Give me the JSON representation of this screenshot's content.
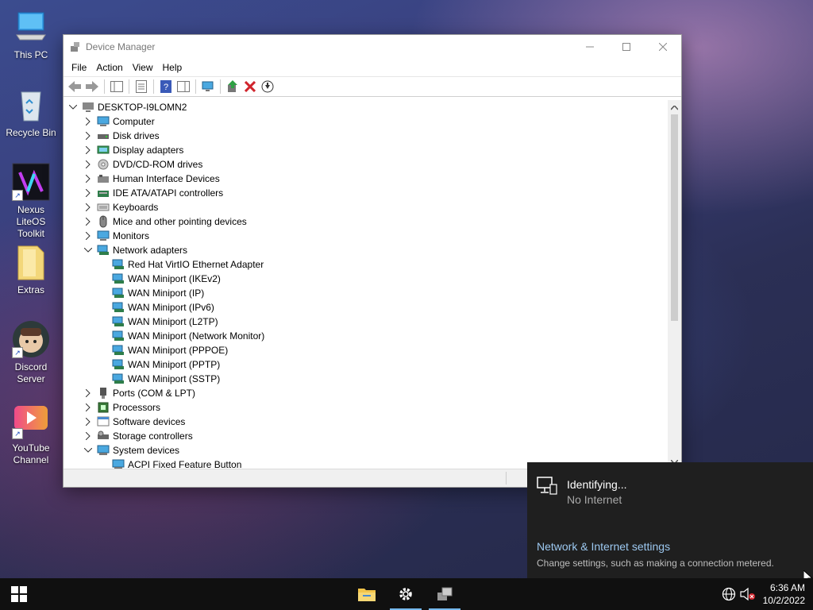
{
  "desktop": {
    "icons": [
      {
        "label": "This PC"
      },
      {
        "label": "Recycle Bin"
      },
      {
        "label": "Nexus LiteOS Toolkit"
      },
      {
        "label": "Extras"
      },
      {
        "label": "Discord Server"
      },
      {
        "label": "YouTube Channel"
      }
    ]
  },
  "window": {
    "title": "Device Manager",
    "menu": [
      "File",
      "Action",
      "View",
      "Help"
    ],
    "tree": {
      "root": "DESKTOP-I9LOMN2",
      "items": [
        {
          "label": "Computer"
        },
        {
          "label": "Disk drives"
        },
        {
          "label": "Display adapters"
        },
        {
          "label": "DVD/CD-ROM drives"
        },
        {
          "label": "Human Interface Devices"
        },
        {
          "label": "IDE ATA/ATAPI controllers"
        },
        {
          "label": "Keyboards"
        },
        {
          "label": "Mice and other pointing devices"
        },
        {
          "label": "Monitors"
        },
        {
          "label": "Network adapters"
        },
        {
          "label": "Red Hat VirtIO Ethernet Adapter"
        },
        {
          "label": "WAN Miniport (IKEv2)"
        },
        {
          "label": "WAN Miniport (IP)"
        },
        {
          "label": "WAN Miniport (IPv6)"
        },
        {
          "label": "WAN Miniport (L2TP)"
        },
        {
          "label": "WAN Miniport (Network Monitor)"
        },
        {
          "label": "WAN Miniport (PPPOE)"
        },
        {
          "label": "WAN Miniport (PPTP)"
        },
        {
          "label": "WAN Miniport (SSTP)"
        },
        {
          "label": "Ports (COM & LPT)"
        },
        {
          "label": "Processors"
        },
        {
          "label": "Software devices"
        },
        {
          "label": "Storage controllers"
        },
        {
          "label": "System devices"
        },
        {
          "label": "ACPI Fixed Feature Button"
        }
      ]
    }
  },
  "flyout": {
    "status_title": "Identifying...",
    "status_sub": "No Internet",
    "settings_link": "Network & Internet settings",
    "settings_desc": "Change settings, such as making a connection metered."
  },
  "taskbar": {
    "time": "6:36 AM",
    "date": "10/2/2022"
  },
  "colors": {
    "accent": "#76b9ed",
    "link": "#9cc8f0",
    "taskbar": "#101010"
  }
}
